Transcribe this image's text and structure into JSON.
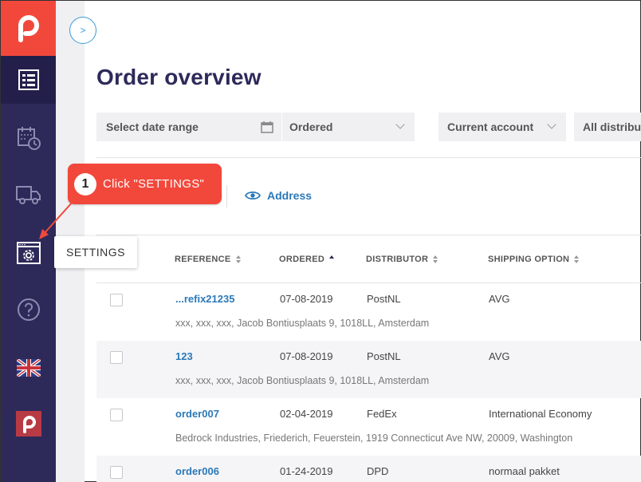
{
  "page": {
    "title": "Order overview"
  },
  "sidebar": {
    "toggle_label": ">",
    "items": [
      {
        "name": "orders",
        "icon": "order-list-icon"
      },
      {
        "name": "planning",
        "icon": "calendar-clock-icon"
      },
      {
        "name": "shipments",
        "icon": "truck-icon"
      },
      {
        "name": "settings",
        "icon": "settings-window-icon"
      },
      {
        "name": "help",
        "icon": "help-icon"
      },
      {
        "name": "language",
        "icon": "uk-flag-icon"
      },
      {
        "name": "brand",
        "icon": "brand-small-icon"
      }
    ]
  },
  "filters": {
    "date_range": "Select date range",
    "status": "Ordered",
    "account": "Current account",
    "distributor": "All distributors"
  },
  "tabs": {
    "address_label": "Address"
  },
  "callout": {
    "number": "1",
    "text": "Click \"SETTINGS\""
  },
  "tooltip": {
    "text": "SETTINGS"
  },
  "table": {
    "headers": {
      "reference": "REFERENCE",
      "ordered": "ORDERED",
      "distributor": "DISTRIBUTOR",
      "shipping": "SHIPPING OPTION"
    },
    "rows": [
      {
        "reference": "...refix21235",
        "ordered": "07-08-2019",
        "distributor": "PostNL",
        "shipping": "AVG",
        "address": "xxx, xxx, xxx, Jacob Bontiusplaats 9, 1018LL, Amsterdam"
      },
      {
        "reference": "123",
        "ordered": "07-08-2019",
        "distributor": "PostNL",
        "shipping": "AVG",
        "address": "xxx, xxx, xxx, Jacob Bontiusplaats 9, 1018LL, Amsterdam"
      },
      {
        "reference": "order007",
        "ordered": "02-04-2019",
        "distributor": "FedEx",
        "shipping": "International Economy",
        "address": "Bedrock Industries, Friederich, Feuerstein, 1919 Connecticut Ave NW, 20009, Washington"
      },
      {
        "reference": "order006",
        "ordered": "01-24-2019",
        "distributor": "DPD",
        "shipping": "normaal pakket",
        "address": ""
      }
    ]
  },
  "colors": {
    "brand": "#f2483c",
    "sidebar": "#2d2a5a",
    "link": "#2b78b8"
  }
}
